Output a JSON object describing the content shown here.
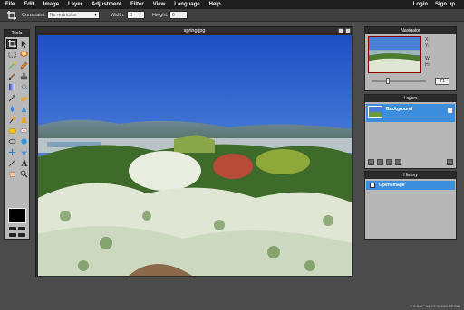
{
  "menu": {
    "items": [
      "File",
      "Edit",
      "Image",
      "Layer",
      "Adjustment",
      "Filter",
      "View",
      "Language",
      "Help"
    ],
    "right": [
      "Login",
      "Sign up"
    ]
  },
  "options": {
    "constraint_label": "Constraint:",
    "constraint_value": "No restriction",
    "width_label": "Width:",
    "width_value": "0",
    "height_label": "Height:",
    "height_value": "0"
  },
  "tools": {
    "title": "Tools"
  },
  "image_window": {
    "title": "spring.jpg"
  },
  "navigator": {
    "title": "Navigator",
    "x_label": "X:",
    "y_label": "Y:",
    "w_label": "W:",
    "h_label": "H:",
    "zoom": "71"
  },
  "layers": {
    "title": "Layers",
    "items": [
      {
        "name": "Background"
      }
    ]
  },
  "history": {
    "title": "History",
    "items": [
      {
        "name": "Open image"
      }
    ]
  },
  "status": "v 4.5.3 - 61 FPS 210.36 MB",
  "colors": {
    "menubar": "#1e1e1e",
    "panel": "#b7b7b7",
    "selection": "#3c8ddb",
    "workspace": "#4b4b4b"
  }
}
